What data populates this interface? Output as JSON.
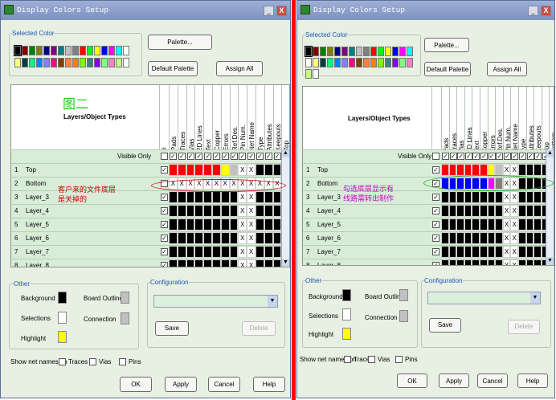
{
  "left": {
    "title": "Display Colors Setup",
    "selected_color_label": "Selected Color",
    "palette_btn": "Palette...",
    "default_palette_btn": "Default Palette",
    "assign_all_btn": "Assign All",
    "layers_header": "Layers/Object Types",
    "hash_header": "#",
    "columns": [
      "Pads",
      "Traces",
      "Vias",
      "2D Lines",
      "Text",
      "Copper",
      "Errors",
      "Ref.Des.",
      "Pin Num.",
      "Net Name",
      "Type",
      "Attributes",
      "Keepouts",
      "Top",
      "Bottom"
    ],
    "visible_only": "Visible Only",
    "rows": [
      {
        "num": "1",
        "name": "Top"
      },
      {
        "num": "2",
        "name": "Bottom"
      },
      {
        "num": "3",
        "name": "Layer_3"
      },
      {
        "num": "4",
        "name": "Layer_4"
      },
      {
        "num": "5",
        "name": "Layer_5"
      },
      {
        "num": "6",
        "name": "Layer_6"
      },
      {
        "num": "7",
        "name": "Layer_7"
      },
      {
        "num": "8",
        "name": "Layer_8"
      }
    ],
    "annotation_title": "图二",
    "annotation_note_line1": "客户来的文件底层",
    "annotation_note_line2": "是关掉的",
    "other_label": "Other",
    "background_label": "Background",
    "selections_label": "Selections",
    "highlight_label": "Highlight",
    "board_outline_label": "Board Outline",
    "connection_label": "Connection",
    "configuration_label": "Configuration",
    "save_btn": "Save",
    "delete_btn": "Delete",
    "show_net_names": "Show net names on",
    "traces_cb": "Traces",
    "vias_cb": "Vias",
    "pins_cb": "Pins",
    "ok_btn": "OK",
    "apply_btn": "Apply",
    "cancel_btn": "Cancel",
    "help_btn": "Help"
  },
  "right": {
    "title": "Display Colors Setup",
    "selected_color_label": "Selected Color",
    "palette_btn": "Palette...",
    "default_palette_btn": "Default Palette",
    "assign_all_btn": "Assign All",
    "layers_header": "Layers/Object Types",
    "hash_header": "#",
    "columns": [
      "Pads",
      "Traces",
      "Vias",
      "2D Lines",
      "Text",
      "Copper",
      "Errors",
      "Ref.Des.",
      "Pin Num.",
      "Net Name",
      "Type",
      "Attributes",
      "Keepouts",
      "Top",
      "Bottom"
    ],
    "visible_only": "Visible Only",
    "rows": [
      {
        "num": "1",
        "name": "Top"
      },
      {
        "num": "2",
        "name": "Bottom"
      },
      {
        "num": "3",
        "name": "Layer_3"
      },
      {
        "num": "4",
        "name": "Layer_4"
      },
      {
        "num": "5",
        "name": "Layer_5"
      },
      {
        "num": "6",
        "name": "Layer_6"
      },
      {
        "num": "7",
        "name": "Layer_7"
      },
      {
        "num": "8",
        "name": "Layer_8"
      }
    ],
    "annotation_note_line1": "勾选底层显示有",
    "annotation_note_line2": "线路需转出制作",
    "other_label": "Other",
    "background_label": "Background",
    "selections_label": "Selections",
    "highlight_label": "Highlight",
    "board_outline_label": "Board Outline",
    "connection_label": "Connection",
    "configuration_label": "Configuration",
    "save_btn": "Save",
    "delete_btn": "Delete",
    "show_net_names": "Show net names on",
    "traces_cb": "Traces",
    "vias_cb": "Vias",
    "pins_cb": "Pins",
    "ok_btn": "OK",
    "apply_btn": "Apply",
    "cancel_btn": "Cancel",
    "help_btn": "Help"
  },
  "colors": {
    "palette": [
      "#000000",
      "#7f0000",
      "#007f00",
      "#7f7f00",
      "#00007f",
      "#7f007f",
      "#007f7f",
      "#c0c0c0",
      "#808080",
      "#ff0000",
      "#00ff00",
      "#ffff00",
      "#0000ff",
      "#ff00ff",
      "#00ffff",
      "#ffffff",
      "#ffff80",
      "#004040",
      "#00ff80",
      "#0080ff",
      "#8080ff",
      "#ff0080",
      "#804000",
      "#ff8040",
      "#ff8000",
      "#80ff00",
      "#408080",
      "#8000ff",
      "#80ff80",
      "#ff80c0",
      "#c0ff80",
      "#ffffff"
    ],
    "top_row": [
      "#ff0000",
      "#ff0000",
      "#ff0000",
      "#ff0000",
      "#ff0000",
      "#ff0000",
      "#ffff00",
      "#c0c0c0",
      "x",
      "x",
      "#000000",
      "#000000",
      "#000000",
      "#000000",
      "#000000"
    ],
    "bottom_row_right": [
      "#0000ff",
      "#0000ff",
      "#0000ff",
      "#0000ff",
      "#0000ff",
      "#0000ff",
      "#ff00ff",
      "#808080",
      "x",
      "x",
      "#000000",
      "#000000",
      "#000000",
      "#000000",
      "#000000"
    ],
    "background": "#000000",
    "selections": "#ffffff",
    "highlight": "#ffff00",
    "board_outline": "#c0c0c0",
    "connection": "#c0c0c0",
    "annotation_green": "#22cc22",
    "annotation_red": "#cc0000",
    "annotation_magenta": "#cc00cc",
    "divider": "#ff0000"
  }
}
